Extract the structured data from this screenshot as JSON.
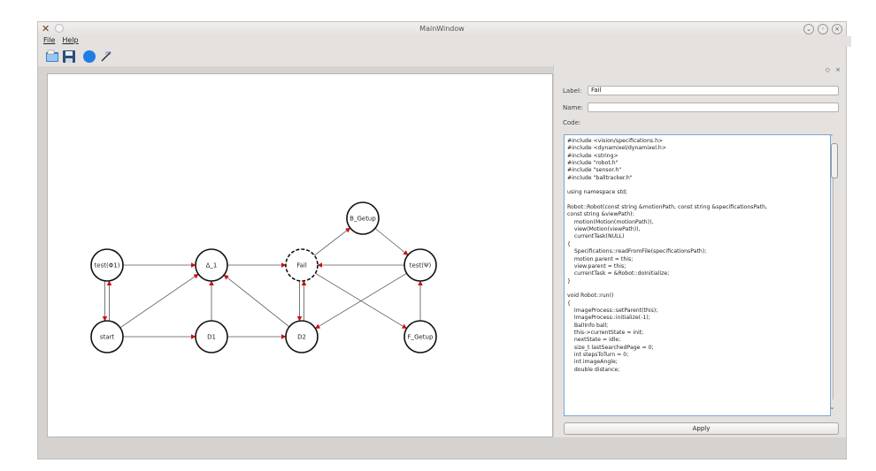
{
  "window": {
    "title": "MainWindow"
  },
  "menu": {
    "items": [
      "File",
      "Help"
    ]
  },
  "toolbar": {
    "icons": [
      "open-file-icon",
      "save-icon",
      "add-state-circle-icon",
      "add-transition-pen-icon"
    ]
  },
  "dock": {
    "label_caption": "Label:",
    "label_value": "Fail",
    "name_caption": "Name:",
    "name_value": "",
    "code_caption": "Code:",
    "code_lines": [
      "#include <vision/specifications.h>",
      "#include <dynamixel/dynamixel.h>",
      "#include <string>",
      "#include \"robot.h\"",
      "#include \"sensor.h\"",
      "#include \"balltracker.h\"",
      "",
      "using namespace std;",
      "",
      "Robot::Robot(const string &motionPath, const string &specificationsPath,",
      "const string &viewPath):",
      "    motion(Motion(motionPath)),",
      "    view(Motion(viewPath)),",
      "    currentTask(NULL)",
      "{",
      "    Specifications::readFromFile(specificationsPath);",
      "    motion.parent = this;",
      "    view.parent = this;",
      "    currentTask = &Robot::doInitialize;",
      "}",
      "",
      "void Robot::run()",
      "{",
      "    ImageProcess::setParent(this);",
      "    ImageProcess::initialize(-1);",
      "    BallInfo ball;",
      "    this->currentState = init;",
      "    nextState = idle;",
      "    size_t lastSearchedPage = 0;",
      "    int stepsToTurn = 0;",
      "    int imageAngle;",
      "    double distance;"
    ],
    "apply_label": "Apply"
  },
  "graph": {
    "nodes": [
      {
        "id": "test_phi1",
        "label": "test(Φ1)"
      },
      {
        "id": "start",
        "label": "start"
      },
      {
        "id": "delta1",
        "label": "Δ_1"
      },
      {
        "id": "d1",
        "label": "D1"
      },
      {
        "id": "fail",
        "label": "Fail"
      },
      {
        "id": "d2",
        "label": "D2"
      },
      {
        "id": "b_getup",
        "label": "B_Getup"
      },
      {
        "id": "test_psi",
        "label": "test(Ψ)"
      },
      {
        "id": "f_getup",
        "label": "F_Getup"
      }
    ],
    "edges": [
      {
        "from": "test_phi1",
        "to": "delta1"
      },
      {
        "from": "test_phi1",
        "to": "start"
      },
      {
        "from": "start",
        "to": "test_phi1"
      },
      {
        "from": "start",
        "to": "delta1"
      },
      {
        "from": "start",
        "to": "d1"
      },
      {
        "from": "d1",
        "to": "delta1"
      },
      {
        "from": "d1",
        "to": "d2"
      },
      {
        "from": "delta1",
        "to": "fail"
      },
      {
        "from": "d2",
        "to": "delta1"
      },
      {
        "from": "fail",
        "to": "d2"
      },
      {
        "from": "d2",
        "to": "fail"
      },
      {
        "from": "fail",
        "to": "b_getup"
      },
      {
        "from": "b_getup",
        "to": "test_psi"
      },
      {
        "from": "test_psi",
        "to": "fail"
      },
      {
        "from": "test_psi",
        "to": "d2"
      },
      {
        "from": "fail",
        "to": "f_getup"
      },
      {
        "from": "f_getup",
        "to": "test_psi"
      }
    ],
    "selected": "fail",
    "colors": {
      "arrow": "#cc1111",
      "line": "#555555"
    }
  }
}
